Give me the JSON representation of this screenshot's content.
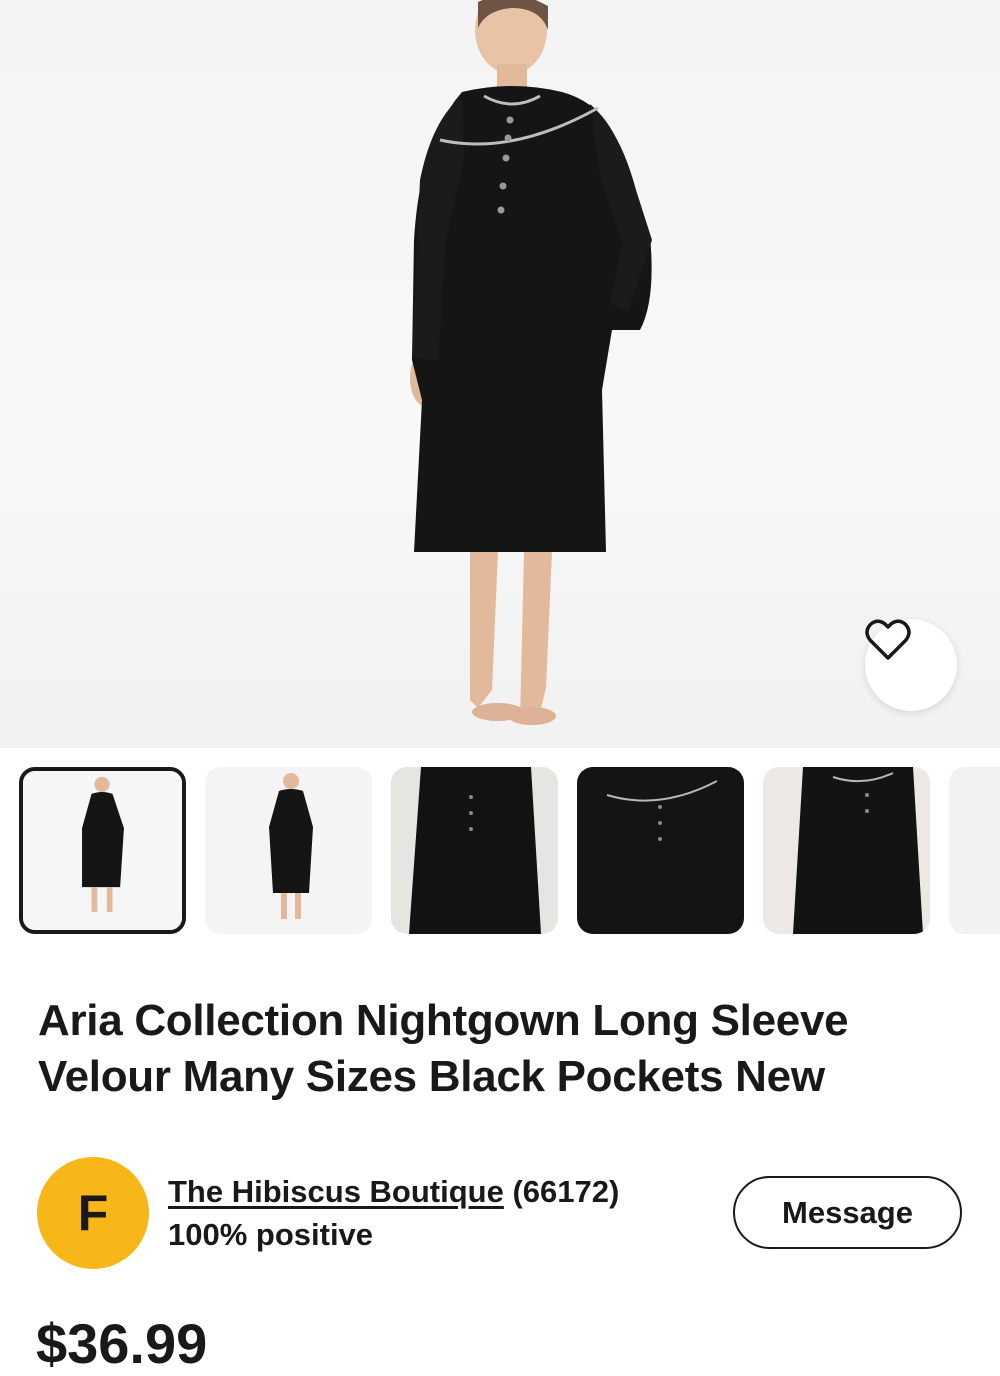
{
  "product": {
    "title": "Aria Collection Nightgown Long Sleeve Velour Many Sizes Black Pockets New",
    "price": "$36.99"
  },
  "gallery": {
    "favorite_icon": "heart-outline-icon",
    "thumbnail_count_visible": 6,
    "selected_index": 0
  },
  "seller": {
    "avatar_letter": "F",
    "name": "The Hibiscus Boutique",
    "feedback_count": "(66172)",
    "positive": "100% positive",
    "message_label": "Message"
  },
  "colors": {
    "avatar": "#f7b718",
    "text": "#191919",
    "garment": "#151515"
  }
}
